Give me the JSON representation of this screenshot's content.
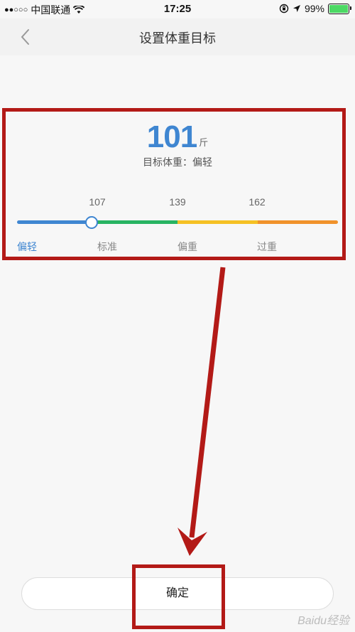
{
  "status_bar": {
    "signal": "●●○○○",
    "carrier": "中国联通",
    "time": "17:25",
    "battery_percent": "99%",
    "battery_level": 0.99
  },
  "nav": {
    "title": "设置体重目标"
  },
  "weight": {
    "value": "101",
    "unit": "斤",
    "goal_label": "目标体重：偏轻"
  },
  "scale": {
    "ticks": [
      "107",
      "139",
      "162"
    ],
    "categories": [
      {
        "label": "偏轻",
        "color": "#3f86d1",
        "active": true
      },
      {
        "label": "标准",
        "color": "#28b462",
        "active": false
      },
      {
        "label": "偏重",
        "color": "#f5c124",
        "active": false
      },
      {
        "label": "过重",
        "color": "#f0922b",
        "active": false
      }
    ]
  },
  "confirm": {
    "label": "确定"
  },
  "watermark": "Baidu经验"
}
